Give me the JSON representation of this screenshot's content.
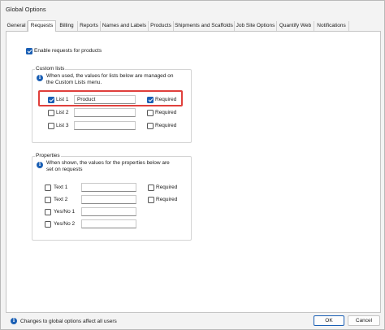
{
  "window": {
    "title": "Global Options"
  },
  "tabs": [
    {
      "label": "General"
    },
    {
      "label": "Requests"
    },
    {
      "label": "Billing"
    },
    {
      "label": "Reports"
    },
    {
      "label": "Names and Labels"
    },
    {
      "label": "Products"
    },
    {
      "label": "Shipments and Scaffolds"
    },
    {
      "label": "Job Site Options"
    },
    {
      "label": "Quantify Web"
    },
    {
      "label": "Notifications"
    }
  ],
  "active_tab": "Requests",
  "enable_requests": {
    "label": "Enable requests for products",
    "checked": true
  },
  "custom_lists": {
    "title": "Custom lists",
    "info": [
      "When used, the values for lists below are managed on",
      "the Custom Lists menu."
    ],
    "rows": [
      {
        "label": "List 1",
        "value": "Product",
        "checked": true,
        "required_label": "Required",
        "required_checked": true
      },
      {
        "label": "List 2",
        "value": "",
        "checked": false,
        "required_label": "Required",
        "required_checked": false
      },
      {
        "label": "List 3",
        "value": "",
        "checked": false,
        "required_label": "Required",
        "required_checked": false
      }
    ]
  },
  "properties": {
    "title": "Properties",
    "info": [
      "When shown, the values for the properties below are",
      "set on requests"
    ],
    "rows": [
      {
        "label": "Text 1",
        "value": "",
        "checked": false,
        "required_label": "Required",
        "required_checked": false
      },
      {
        "label": "Text 2",
        "value": "",
        "checked": false,
        "required_label": "Required",
        "required_checked": false
      },
      {
        "label": "Yes/No 1",
        "value": "",
        "checked": false
      },
      {
        "label": "Yes/No 2",
        "value": "",
        "checked": false
      }
    ]
  },
  "footer": {
    "info": "Changes to global options affect all users",
    "ok_label": "OK",
    "cancel_label": "Cancel"
  },
  "colors": {
    "accent": "#1a5fb4",
    "highlight": "#e0403c"
  }
}
